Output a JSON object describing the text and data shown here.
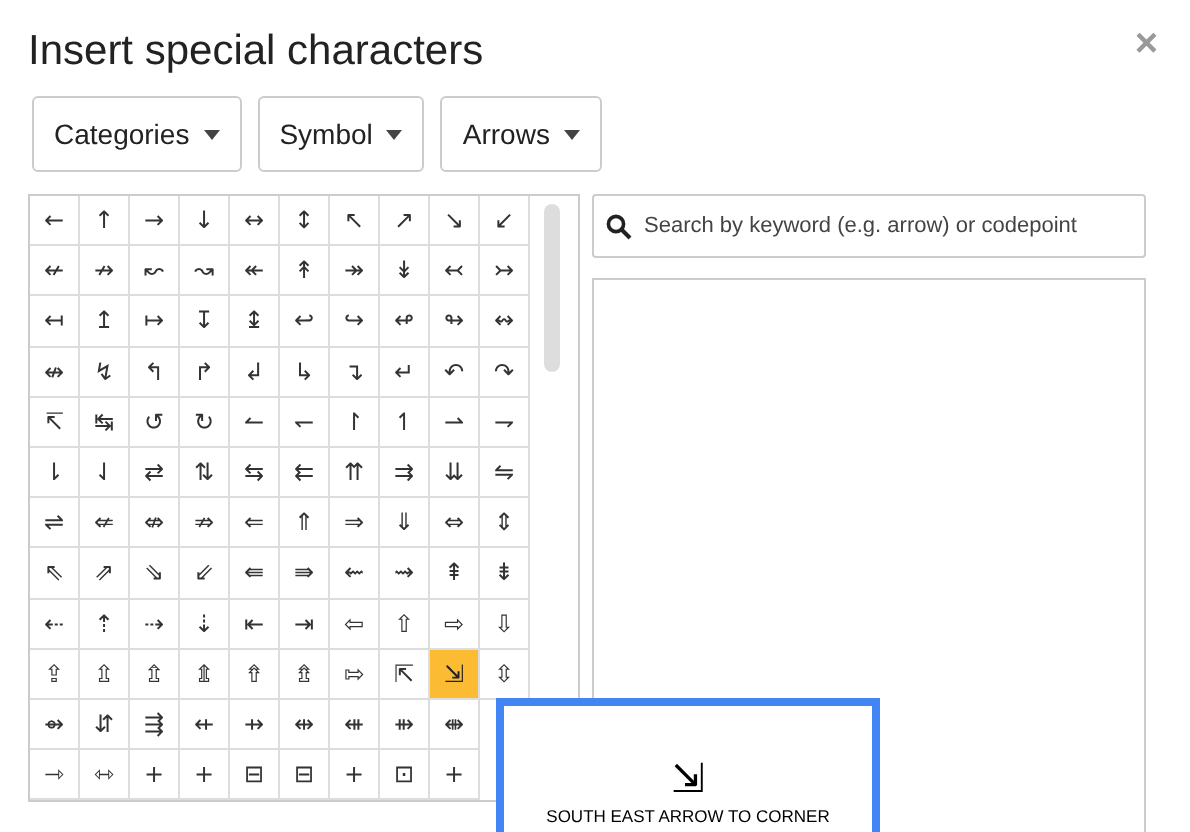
{
  "dialog": {
    "title": "Insert special characters",
    "close": "×"
  },
  "dropdowns": [
    {
      "label": "Categories"
    },
    {
      "label": "Symbol"
    },
    {
      "label": "Arrows"
    }
  ],
  "grid": {
    "rows": [
      [
        {
          "char": "←",
          "selected": false
        },
        {
          "char": "↑",
          "selected": false
        },
        {
          "char": "→",
          "selected": false
        },
        {
          "char": "↓",
          "selected": false
        },
        {
          "char": "↔",
          "selected": false
        },
        {
          "char": "↕",
          "selected": false
        },
        {
          "char": "↖",
          "selected": false
        },
        {
          "char": "↗",
          "selected": false
        },
        {
          "char": "↘",
          "selected": false
        },
        {
          "char": "↙",
          "selected": false
        }
      ],
      [
        {
          "char": "↚",
          "selected": false
        },
        {
          "char": "↛",
          "selected": false
        },
        {
          "char": "↜",
          "selected": false
        },
        {
          "char": "↝",
          "selected": false
        },
        {
          "char": "↞",
          "selected": false
        },
        {
          "char": "↟",
          "selected": false
        },
        {
          "char": "↠",
          "selected": false
        },
        {
          "char": "↡",
          "selected": false
        },
        {
          "char": "↢",
          "selected": false
        },
        {
          "char": "↣",
          "selected": false
        }
      ],
      [
        {
          "char": "↤",
          "selected": false
        },
        {
          "char": "↥",
          "selected": false
        },
        {
          "char": "↦",
          "selected": false
        },
        {
          "char": "↧",
          "selected": false
        },
        {
          "char": "↨",
          "selected": false
        },
        {
          "char": "↩",
          "selected": false
        },
        {
          "char": "↪",
          "selected": false
        },
        {
          "char": "↫",
          "selected": false
        },
        {
          "char": "↬",
          "selected": false
        },
        {
          "char": "↭",
          "selected": false
        }
      ],
      [
        {
          "char": "↮",
          "selected": false
        },
        {
          "char": "↯",
          "selected": false
        },
        {
          "char": "↰",
          "selected": false
        },
        {
          "char": "↱",
          "selected": false
        },
        {
          "char": "↲",
          "selected": false
        },
        {
          "char": "↳",
          "selected": false
        },
        {
          "char": "↴",
          "selected": false
        },
        {
          "char": "↵",
          "selected": false
        },
        {
          "char": "↶",
          "selected": false
        },
        {
          "char": "↷",
          "selected": false
        }
      ],
      [
        {
          "char": "↸",
          "selected": false
        },
        {
          "char": "↹",
          "selected": false
        },
        {
          "char": "↺",
          "selected": false
        },
        {
          "char": "↻",
          "selected": false
        },
        {
          "char": "↼",
          "selected": false
        },
        {
          "char": "↽",
          "selected": false
        },
        {
          "char": "↾",
          "selected": false
        },
        {
          "char": "↿",
          "selected": false
        },
        {
          "char": "⇀",
          "selected": false
        },
        {
          "char": "⇁",
          "selected": false
        }
      ],
      [
        {
          "char": "⇂",
          "selected": false
        },
        {
          "char": "⇃",
          "selected": false
        },
        {
          "char": "⇄",
          "selected": false
        },
        {
          "char": "⇅",
          "selected": false
        },
        {
          "char": "⇆",
          "selected": false
        },
        {
          "char": "⇇",
          "selected": false
        },
        {
          "char": "⇈",
          "selected": false
        },
        {
          "char": "⇉",
          "selected": false
        },
        {
          "char": "⇊",
          "selected": false
        },
        {
          "char": "⇋",
          "selected": false
        }
      ],
      [
        {
          "char": "⇌",
          "selected": false
        },
        {
          "char": "⇍",
          "selected": false
        },
        {
          "char": "⇎",
          "selected": false
        },
        {
          "char": "⇏",
          "selected": false
        },
        {
          "char": "⇐",
          "selected": false
        },
        {
          "char": "⇑",
          "selected": false
        },
        {
          "char": "⇒",
          "selected": false
        },
        {
          "char": "⇓",
          "selected": false
        },
        {
          "char": "⇔",
          "selected": false
        },
        {
          "char": "⇕",
          "selected": false
        }
      ],
      [
        {
          "char": "⇖",
          "selected": false
        },
        {
          "char": "⇗",
          "selected": false
        },
        {
          "char": "⇘",
          "selected": false
        },
        {
          "char": "⇙",
          "selected": false
        },
        {
          "char": "⇚",
          "selected": false
        },
        {
          "char": "⇛",
          "selected": false
        },
        {
          "char": "⇜",
          "selected": false
        },
        {
          "char": "⇝",
          "selected": false
        },
        {
          "char": "⇞",
          "selected": false
        },
        {
          "char": "⇟",
          "selected": false
        }
      ],
      [
        {
          "char": "⇠",
          "selected": false
        },
        {
          "char": "⇡",
          "selected": false
        },
        {
          "char": "⇢",
          "selected": false
        },
        {
          "char": "⇣",
          "selected": false
        },
        {
          "char": "⇤",
          "selected": false
        },
        {
          "char": "⇥",
          "selected": false
        },
        {
          "char": "⇦",
          "selected": false
        },
        {
          "char": "⇧",
          "selected": false
        },
        {
          "char": "⇨",
          "selected": false
        },
        {
          "char": "⇩",
          "selected": false
        }
      ],
      [
        {
          "char": "⇪",
          "selected": false
        },
        {
          "char": "⇫",
          "selected": false
        },
        {
          "char": "⇬",
          "selected": false
        },
        {
          "char": "⇭",
          "selected": false
        },
        {
          "char": "⇮",
          "selected": false
        },
        {
          "char": "⇯",
          "selected": false
        },
        {
          "char": "⇰",
          "selected": false
        },
        {
          "char": "⇱",
          "selected": false
        },
        {
          "char": "⇲",
          "selected": true
        },
        {
          "char": "⇳",
          "selected": false
        }
      ],
      [
        {
          "char": "⇴",
          "selected": false
        },
        {
          "char": "⇵",
          "selected": false
        },
        {
          "char": "⇶",
          "selected": false
        },
        {
          "char": "⇷",
          "selected": false
        },
        {
          "char": "⇸",
          "selected": false
        },
        {
          "char": "⇹",
          "selected": false
        },
        {
          "char": "⇺",
          "selected": false
        },
        {
          "char": "⇻",
          "selected": false
        },
        {
          "char": "⇼",
          "selected": false
        }
      ],
      [
        {
          "char": "⇾",
          "selected": false
        },
        {
          "char": "⇿",
          "selected": false
        },
        {
          "char": "+",
          "selected": false
        },
        {
          "char": "+",
          "selected": false
        },
        {
          "char": "⊟",
          "selected": false
        },
        {
          "char": "⊟",
          "selected": false
        },
        {
          "char": "+",
          "selected": false
        },
        {
          "char": "⊡",
          "selected": false
        },
        {
          "char": "+",
          "selected": false
        }
      ]
    ]
  },
  "search": {
    "placeholder": "Search by keyword (e.g. arrow) or codepoint"
  },
  "preview": {
    "glyph": "⇲",
    "name": "SOUTH EAST ARROW TO CORNER"
  }
}
